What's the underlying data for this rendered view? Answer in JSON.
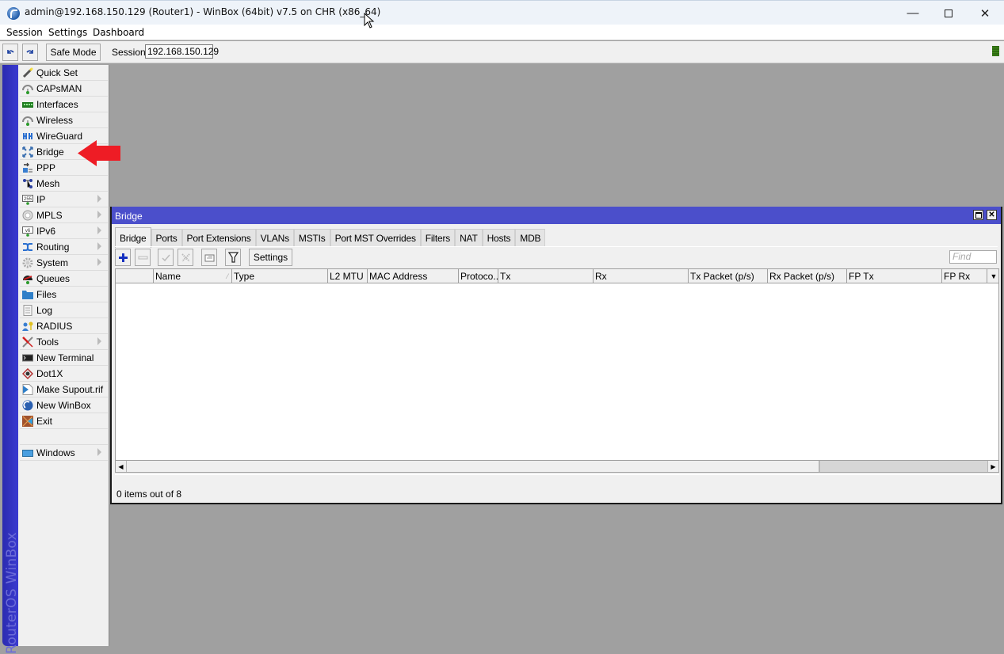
{
  "window": {
    "title": "admin@192.168.150.129 (Router1) - WinBox (64bit) v7.5 on CHR (x86_64)",
    "controls": [
      "minimize",
      "maximize",
      "close"
    ]
  },
  "menubar": [
    "Session",
    "Settings",
    "Dashboard"
  ],
  "toolbar": {
    "undo_icon": "undo-icon",
    "redo_icon": "redo-icon",
    "safe_mode_label": "Safe Mode",
    "session_label": "Session:",
    "session_value": "192.168.150.129"
  },
  "sidebar": {
    "brand": "RouterOS WinBox",
    "items": [
      {
        "label": "Quick Set",
        "icon": "wand-icon",
        "submenu": false
      },
      {
        "label": "CAPsMAN",
        "icon": "antenna-icon",
        "submenu": false
      },
      {
        "label": "Interfaces",
        "icon": "interface-card-icon",
        "submenu": false
      },
      {
        "label": "Wireless",
        "icon": "antenna-icon",
        "submenu": false
      },
      {
        "label": "WireGuard",
        "icon": "wireguard-icon",
        "submenu": false
      },
      {
        "label": "Bridge",
        "icon": "bridge-icon",
        "submenu": false
      },
      {
        "label": "PPP",
        "icon": "ppp-icon",
        "submenu": false
      },
      {
        "label": "Mesh",
        "icon": "mesh-icon",
        "submenu": false
      },
      {
        "label": "IP",
        "icon": "ip-icon",
        "submenu": true
      },
      {
        "label": "MPLS",
        "icon": "mpls-icon",
        "submenu": true
      },
      {
        "label": "IPv6",
        "icon": "ipv6-icon",
        "submenu": true
      },
      {
        "label": "Routing",
        "icon": "routing-icon",
        "submenu": true
      },
      {
        "label": "System",
        "icon": "gear-icon",
        "submenu": true
      },
      {
        "label": "Queues",
        "icon": "queues-icon",
        "submenu": false
      },
      {
        "label": "Files",
        "icon": "folder-icon",
        "submenu": false
      },
      {
        "label": "Log",
        "icon": "log-icon",
        "submenu": false
      },
      {
        "label": "RADIUS",
        "icon": "radius-icon",
        "submenu": false
      },
      {
        "label": "Tools",
        "icon": "tools-icon",
        "submenu": true
      },
      {
        "label": "New Terminal",
        "icon": "terminal-icon",
        "submenu": false
      },
      {
        "label": "Dot1X",
        "icon": "dot1x-icon",
        "submenu": false
      },
      {
        "label": "Make Supout.rif",
        "icon": "supout-icon",
        "submenu": false
      },
      {
        "label": "New WinBox",
        "icon": "winbox-icon",
        "submenu": false
      },
      {
        "label": "Exit",
        "icon": "exit-icon",
        "submenu": false
      },
      {
        "label": "",
        "icon": "",
        "submenu": false
      },
      {
        "label": "Windows",
        "icon": "windows-icon",
        "submenu": true
      }
    ]
  },
  "annotation": {
    "type": "red-arrow",
    "points_to": "Bridge"
  },
  "bridge_window": {
    "title": "Bridge",
    "tabs": [
      "Bridge",
      "Ports",
      "Port Extensions",
      "VLANs",
      "MSTIs",
      "Port MST Overrides",
      "Filters",
      "NAT",
      "Hosts",
      "MDB"
    ],
    "active_tab": "Bridge",
    "actions": {
      "add_icon": "plus-icon",
      "remove_icon": "minus-icon",
      "enable_icon": "check-icon",
      "disable_icon": "x-icon",
      "comment_icon": "comment-icon",
      "filter_icon": "filter-icon",
      "settings_label": "Settings"
    },
    "find_placeholder": "Find",
    "columns": [
      "",
      "Name",
      "Type",
      "L2 MTU",
      "MAC Address",
      "Protoco...",
      "Tx",
      "Rx",
      "Tx Packet (p/s)",
      "Rx Packet (p/s)",
      "FP Tx",
      "FP Rx"
    ],
    "rows": [],
    "status": "0 items out of 8"
  }
}
